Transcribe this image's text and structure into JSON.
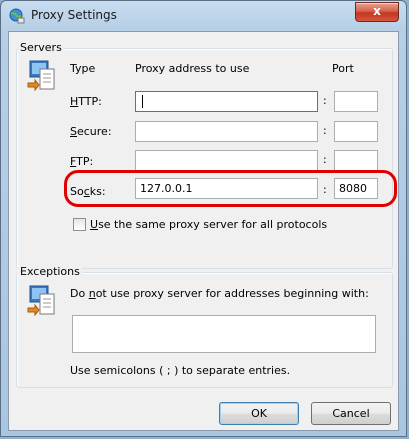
{
  "window": {
    "title": "Proxy Settings",
    "close_glyph": "x"
  },
  "servers": {
    "group_label": "Servers",
    "icon": "network-settings-icon",
    "headers": {
      "type": "Type",
      "address": "Proxy address to use",
      "port": "Port"
    },
    "rows": [
      {
        "label": "HTTP:",
        "underline": "H",
        "rest": "TTP:",
        "address": "",
        "port": "",
        "focused": true
      },
      {
        "label": "Secure:",
        "underline": "S",
        "rest": "ecure:",
        "address": "",
        "port": ""
      },
      {
        "label": "FTP:",
        "underline": "F",
        "rest": "TP:",
        "address": "",
        "port": ""
      },
      {
        "label": "Socks:",
        "pre": "So",
        "underline": "c",
        "rest": "ks:",
        "address": "127.0.0.1",
        "port": "8080"
      }
    ],
    "colon": ":",
    "same_proxy": {
      "underline": "U",
      "rest": "se the same proxy server for all protocols",
      "checked": false
    }
  },
  "exceptions": {
    "group_label": "Exceptions",
    "icon": "network-settings-icon",
    "bypass_pre": "Do ",
    "bypass_underline": "n",
    "bypass_rest": "ot use proxy server for addresses beginning with:",
    "value": "",
    "hint": "Use semicolons ( ; ) to separate entries."
  },
  "buttons": {
    "ok": "OK",
    "cancel": "Cancel"
  },
  "colors": {
    "highlight": "#e00000",
    "window_frame": "#a9c6e0"
  }
}
